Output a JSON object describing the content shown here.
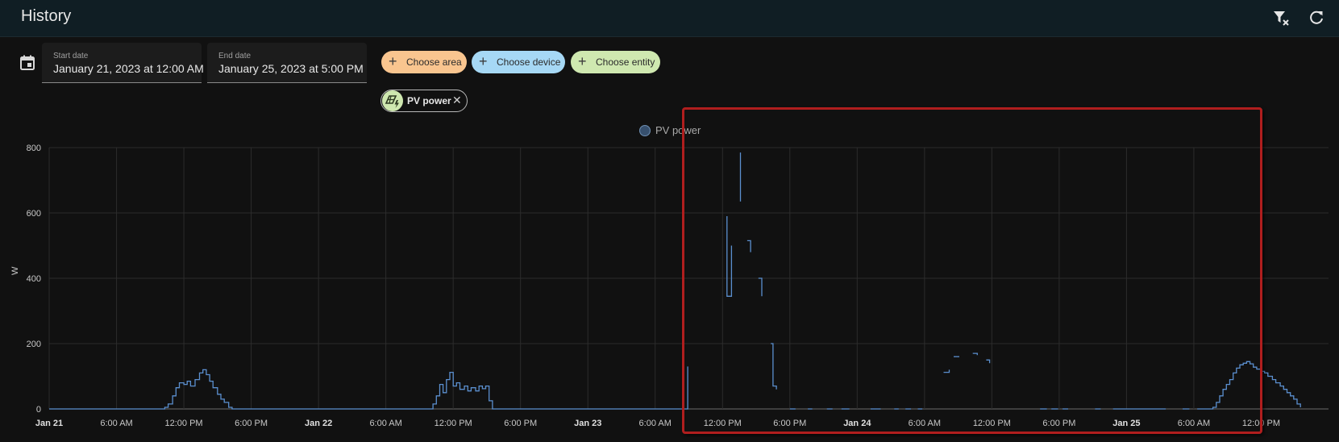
{
  "header": {
    "title": "History",
    "clear_filter_icon": "filter-remove-icon",
    "refresh_icon": "refresh-icon"
  },
  "date_range": {
    "calendar_icon": "calendar-icon",
    "start": {
      "label": "Start date",
      "value": "January 21, 2023 at 12:00 AM"
    },
    "end": {
      "label": "End date",
      "value": "January 25, 2023 at 5:00 PM"
    }
  },
  "pickers": [
    {
      "label": "Choose area",
      "color": "#f9c58f"
    },
    {
      "label": "Choose device",
      "color": "#a6d8f5"
    },
    {
      "label": "Choose entity",
      "color": "#cfe8b0"
    }
  ],
  "selected_entity": {
    "name": "PV power",
    "icon": "solar-power-icon",
    "remove_icon": "close-icon"
  },
  "legend": {
    "series_name": "PV power"
  },
  "colors": {
    "line": "#5b8fcf",
    "highlight": "#b01e1e"
  },
  "chart_data": {
    "type": "line",
    "title": "",
    "xlabel": "",
    "ylabel": "W",
    "ylim": [
      0,
      800
    ],
    "y_ticks": [
      0,
      200,
      400,
      600,
      800
    ],
    "x_range_hours": [
      0,
      114
    ],
    "x_ticks": [
      {
        "label": "Jan 21",
        "bold": true
      },
      {
        "label": "6:00 AM"
      },
      {
        "label": "12:00 PM"
      },
      {
        "label": "6:00 PM"
      },
      {
        "label": "Jan 22",
        "bold": true
      },
      {
        "label": "6:00 AM"
      },
      {
        "label": "12:00 PM"
      },
      {
        "label": "6:00 PM"
      },
      {
        "label": "Jan 23",
        "bold": true
      },
      {
        "label": "6:00 AM"
      },
      {
        "label": "12:00 PM"
      },
      {
        "label": "6:00 PM"
      },
      {
        "label": "Jan 24",
        "bold": true
      },
      {
        "label": "6:00 AM"
      },
      {
        "label": "12:00 PM"
      },
      {
        "label": "6:00 PM"
      },
      {
        "label": "Jan 25",
        "bold": true
      },
      {
        "label": "6:00 AM"
      },
      {
        "label": "12:00 PM"
      }
    ],
    "grid": true,
    "series": [
      {
        "name": "PV power",
        "segments": [
          [
            [
              0,
              0
            ],
            [
              10.3,
              0
            ],
            [
              10.3,
              5
            ],
            [
              10.6,
              5
            ],
            [
              10.6,
              15
            ],
            [
              11,
              15
            ],
            [
              11,
              40
            ],
            [
              11.3,
              40
            ],
            [
              11.3,
              65
            ],
            [
              11.6,
              65
            ],
            [
              11.6,
              80
            ],
            [
              12,
              80
            ],
            [
              12,
              75
            ],
            [
              12.3,
              75
            ],
            [
              12.3,
              85
            ],
            [
              12.6,
              85
            ],
            [
              12.6,
              70
            ],
            [
              13,
              70
            ],
            [
              13,
              90
            ],
            [
              13.4,
              90
            ],
            [
              13.4,
              110
            ],
            [
              13.7,
              110
            ],
            [
              13.7,
              120
            ],
            [
              14,
              120
            ],
            [
              14,
              105
            ],
            [
              14.3,
              105
            ],
            [
              14.3,
              85
            ],
            [
              14.6,
              85
            ],
            [
              14.6,
              65
            ],
            [
              15,
              65
            ],
            [
              15,
              45
            ],
            [
              15.3,
              45
            ],
            [
              15.3,
              30
            ],
            [
              15.6,
              30
            ],
            [
              15.6,
              20
            ],
            [
              16,
              20
            ],
            [
              16,
              5
            ],
            [
              16.3,
              5
            ],
            [
              16.3,
              0
            ],
            [
              34.2,
              0
            ],
            [
              34.2,
              15
            ],
            [
              34.5,
              15
            ],
            [
              34.5,
              40
            ],
            [
              34.8,
              40
            ],
            [
              34.8,
              75
            ],
            [
              35.1,
              75
            ],
            [
              35.1,
              50
            ],
            [
              35.4,
              50
            ],
            [
              35.4,
              90
            ],
            [
              35.7,
              90
            ],
            [
              35.7,
              112
            ],
            [
              36,
              112
            ],
            [
              36,
              70
            ],
            [
              36.3,
              70
            ],
            [
              36.3,
              80
            ],
            [
              36.6,
              80
            ],
            [
              36.6,
              60
            ],
            [
              37,
              60
            ],
            [
              37,
              70
            ],
            [
              37.3,
              70
            ],
            [
              37.3,
              55
            ],
            [
              37.6,
              55
            ],
            [
              37.6,
              65
            ],
            [
              38,
              65
            ],
            [
              38,
              55
            ],
            [
              38.3,
              55
            ],
            [
              38.3,
              70
            ],
            [
              38.6,
              70
            ],
            [
              38.6,
              62
            ],
            [
              38.9,
              62
            ],
            [
              38.9,
              70
            ],
            [
              39.2,
              70
            ],
            [
              39.2,
              25
            ],
            [
              39.5,
              25
            ],
            [
              39.5,
              0
            ],
            [
              56.9,
              0
            ],
            [
              56.9,
              130
            ]
          ],
          [
            [
              60.4,
              590
            ],
            [
              60.4,
              345
            ],
            [
              60.8,
              345
            ],
            [
              60.8,
              500
            ]
          ],
          [
            [
              61.6,
              785
            ],
            [
              61.6,
              635
            ]
          ],
          [
            [
              62.2,
              515
            ],
            [
              62.5,
              515
            ],
            [
              62.5,
              480
            ]
          ],
          [
            [
              63.2,
              400
            ],
            [
              63.5,
              400
            ],
            [
              63.5,
              345
            ]
          ],
          [
            [
              64.3,
              200
            ],
            [
              64.5,
              200
            ],
            [
              64.5,
              70
            ],
            [
              64.8,
              70
            ],
            [
              64.8,
              60
            ]
          ],
          [
            [
              66,
              0
            ],
            [
              66.5,
              0
            ]
          ],
          [
            [
              67.6,
              0
            ],
            [
              68,
              0
            ]
          ],
          [
            [
              69.3,
              0
            ],
            [
              69.8,
              0
            ]
          ],
          [
            [
              70.6,
              0
            ],
            [
              71.3,
              0
            ]
          ],
          [
            [
              73.2,
              0
            ],
            [
              74.1,
              0
            ]
          ],
          [
            [
              75.3,
              0
            ],
            [
              75.7,
              0
            ]
          ],
          [
            [
              76.3,
              0
            ],
            [
              76.8,
              0
            ]
          ],
          [
            [
              77.4,
              0
            ],
            [
              77.8,
              0
            ]
          ],
          [
            [
              79.7,
              112
            ],
            [
              80.2,
              112
            ],
            [
              80.2,
              120
            ]
          ],
          [
            [
              80.6,
              160
            ],
            [
              81.1,
              160
            ]
          ],
          [
            [
              82.3,
              170
            ],
            [
              82.7,
              170
            ],
            [
              82.7,
              165
            ]
          ],
          [
            [
              83.5,
              150
            ],
            [
              83.8,
              150
            ],
            [
              83.8,
              140
            ]
          ],
          [
            [
              88.3,
              0
            ],
            [
              88.9,
              0
            ]
          ],
          [
            [
              89.3,
              0
            ],
            [
              89.9,
              0
            ]
          ],
          [
            [
              90.3,
              0
            ],
            [
              90.8,
              0
            ]
          ],
          [
            [
              93.2,
              0
            ],
            [
              93.7,
              0
            ]
          ],
          [
            [
              94.8,
              0
            ],
            [
              99.5,
              0
            ]
          ],
          [
            [
              101,
              0
            ],
            [
              101.6,
              0
            ]
          ],
          [
            [
              102.3,
              0
            ],
            [
              103.7,
              0
            ],
            [
              103.7,
              5
            ],
            [
              104,
              5
            ],
            [
              104,
              20
            ],
            [
              104.3,
              20
            ],
            [
              104.3,
              40
            ],
            [
              104.6,
              40
            ],
            [
              104.6,
              60
            ],
            [
              104.9,
              60
            ],
            [
              104.9,
              75
            ],
            [
              105.2,
              75
            ],
            [
              105.2,
              90
            ],
            [
              105.5,
              90
            ],
            [
              105.5,
              110
            ],
            [
              105.8,
              110
            ],
            [
              105.8,
              125
            ],
            [
              106.1,
              125
            ],
            [
              106.1,
              135
            ],
            [
              106.4,
              135
            ],
            [
              106.4,
              140
            ],
            [
              106.7,
              140
            ],
            [
              106.7,
              145
            ],
            [
              107,
              145
            ],
            [
              107,
              138
            ],
            [
              107.3,
              138
            ],
            [
              107.3,
              128
            ],
            [
              107.6,
              128
            ],
            [
              107.6,
              122
            ],
            [
              108,
              122
            ],
            [
              108,
              115
            ],
            [
              108.3,
              115
            ],
            [
              108.3,
              110
            ],
            [
              108.6,
              110
            ],
            [
              108.6,
              100
            ],
            [
              109,
              100
            ],
            [
              109,
              90
            ],
            [
              109.3,
              90
            ],
            [
              109.3,
              80
            ],
            [
              109.7,
              80
            ],
            [
              109.7,
              70
            ],
            [
              110,
              70
            ],
            [
              110,
              60
            ],
            [
              110.3,
              60
            ],
            [
              110.3,
              50
            ],
            [
              110.6,
              50
            ],
            [
              110.6,
              40
            ],
            [
              110.9,
              40
            ],
            [
              110.9,
              30
            ],
            [
              111.2,
              30
            ],
            [
              111.2,
              15
            ],
            [
              111.5,
              15
            ],
            [
              111.5,
              5
            ]
          ]
        ]
      }
    ]
  }
}
